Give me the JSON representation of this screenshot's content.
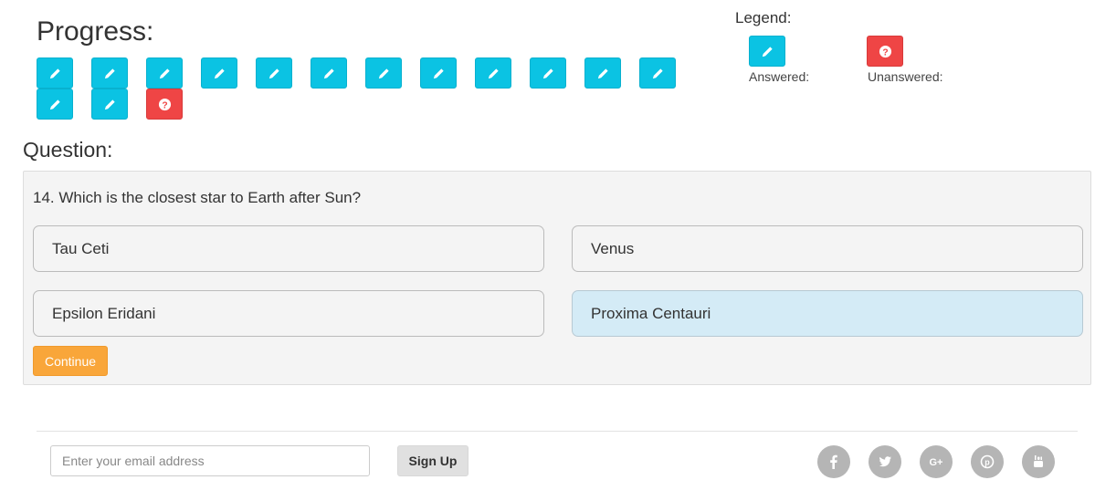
{
  "progress": {
    "title": "Progress:",
    "items": [
      {
        "status": "answered",
        "icon": "pencil-icon"
      },
      {
        "status": "answered",
        "icon": "pencil-icon"
      },
      {
        "status": "answered",
        "icon": "pencil-icon"
      },
      {
        "status": "answered",
        "icon": "pencil-icon"
      },
      {
        "status": "answered",
        "icon": "pencil-icon"
      },
      {
        "status": "answered",
        "icon": "pencil-icon"
      },
      {
        "status": "answered",
        "icon": "pencil-icon"
      },
      {
        "status": "answered",
        "icon": "pencil-icon"
      },
      {
        "status": "answered",
        "icon": "pencil-icon"
      },
      {
        "status": "answered",
        "icon": "pencil-icon"
      },
      {
        "status": "answered",
        "icon": "pencil-icon"
      },
      {
        "status": "answered",
        "icon": "pencil-icon"
      },
      {
        "status": "answered",
        "icon": "pencil-icon"
      },
      {
        "status": "answered",
        "icon": "pencil-icon"
      },
      {
        "status": "unanswered",
        "icon": "question-circle-icon"
      }
    ]
  },
  "legend": {
    "title": "Legend:",
    "answered_label": "Answered:",
    "unanswered_label": "Unanswered:"
  },
  "question": {
    "heading": "Question:",
    "text": "14. Which is the closest star to Earth after Sun?",
    "options": [
      {
        "label": "Tau Ceti",
        "selected": false
      },
      {
        "label": "Venus",
        "selected": false
      },
      {
        "label": "Epsilon Eridani",
        "selected": false
      },
      {
        "label": "Proxima Centauri",
        "selected": true
      }
    ],
    "continue_label": "Continue"
  },
  "footer": {
    "email_placeholder": "Enter your email address",
    "signup_label": "Sign Up",
    "social": [
      "facebook-icon",
      "twitter-icon",
      "google-plus-icon",
      "pinterest-icon",
      "youtube-icon"
    ]
  },
  "colors": {
    "answered": "#0bc3e3",
    "unanswered": "#ef4545",
    "selected_option": "#d4ebf6",
    "continue": "#f9a63a"
  }
}
